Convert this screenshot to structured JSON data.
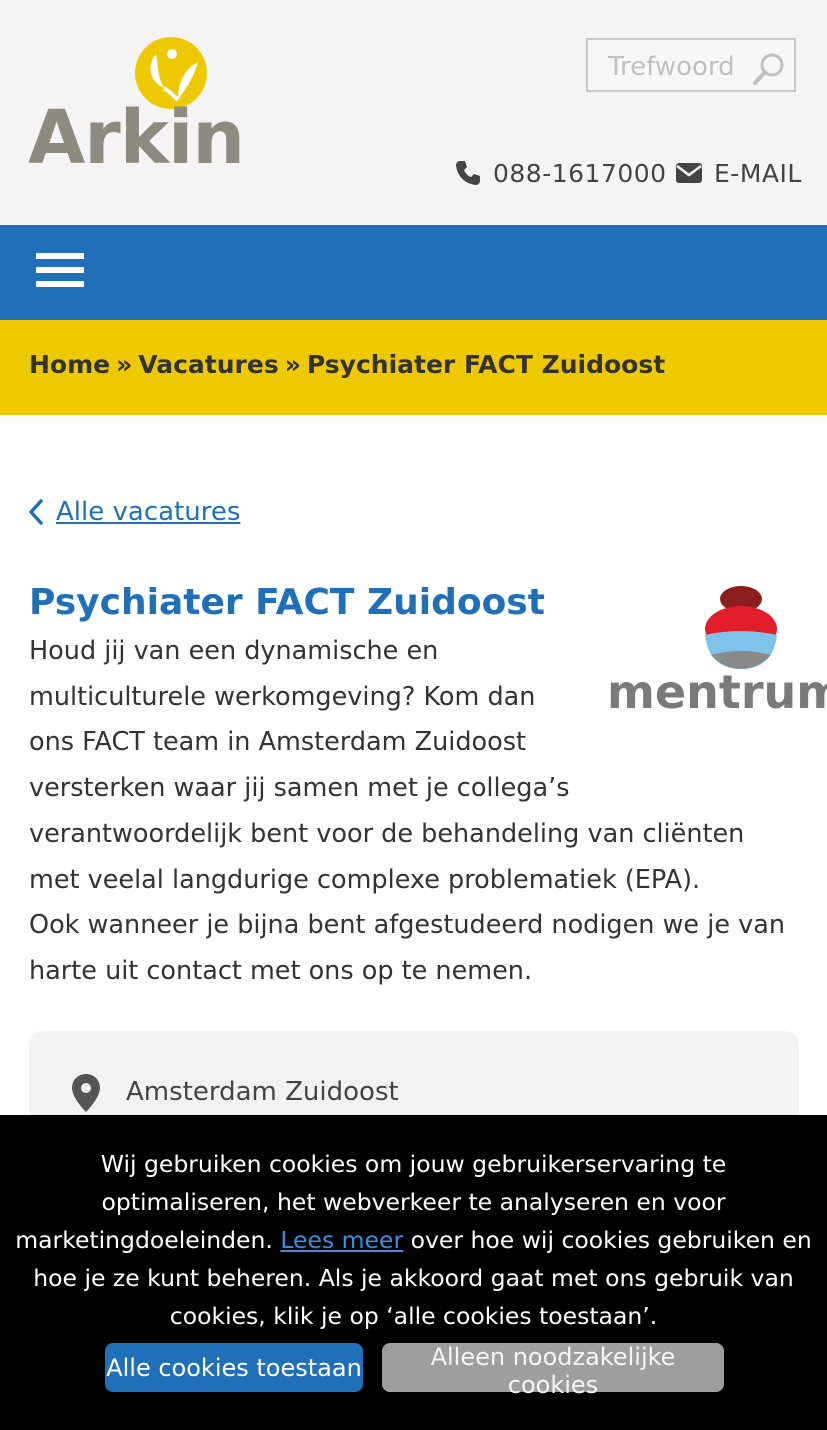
{
  "header": {
    "logo_text": "Arkin",
    "search_placeholder": "Trefwoord",
    "phone": "088-1617000",
    "email_label": "E-MAIL"
  },
  "breadcrumb": {
    "items": [
      "Home",
      "Vacatures",
      "Psychiater FACT Zuidoost"
    ],
    "separator": "»"
  },
  "back_link": "Alle vacatures",
  "vacancy": {
    "title": "Psychiater FACT Zuidoost",
    "partner_logo_text": "mentrum",
    "intro_p1": "Houd jij van een dynamische en multicultu­rele werkomgeving? Kom dan ons FACT team in Amsterdam Zuidoost versterken waar jij samen met je collega’s verantwoordelijk bent voor de behandeling van cliënten  met veelal langdurige com­plexe problematiek (EPA).",
    "intro_p2": "Ook wanneer je bijna bent afgestudeerd nodigen we je van harte uit contact met ons op te nemen.",
    "location": "Amsterdam Zuidoost"
  },
  "cookie": {
    "text_before_link": "Wij gebruiken cookies om jouw gebruikerservaring te optimaliseren, het webverkeer te analyseren en voor marketingdoeleinden.",
    "link_text": "Lees meer",
    "text_after_link": "over hoe wij cookies gebruiken en hoe je ze kunt beheren. Als je ak­koord gaat met ons gebruik van cookies, klik je op ‘alle cookies toestaan’.",
    "accept_all_label": "Alle cookies toestaan",
    "necessary_only_label": "Alleen noodzakelijke cookies"
  },
  "colors": {
    "brand_blue": "#1f70b8",
    "brand_yellow": "#efc900",
    "logo_grey": "#8f8a80"
  }
}
